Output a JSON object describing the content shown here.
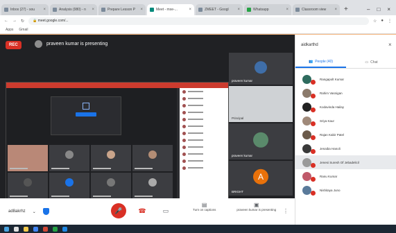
{
  "browser": {
    "tabs": [
      {
        "label": "Inbox (27) - sou"
      },
      {
        "label": "Analysis (980) - n"
      },
      {
        "label": "Prepare Lesson P"
      },
      {
        "label": "Meet - mxe-..."
      },
      {
        "label": "ZMEET - Googl"
      },
      {
        "label": "Whatsapp"
      },
      {
        "label": "Classroom view"
      }
    ],
    "url": "meet.google.com/...",
    "bookmarks": [
      "Apps",
      "Gmail"
    ]
  },
  "meet": {
    "rec_label": "REC",
    "presenter_text": "praveen kumar is presenting",
    "side_tile_names": [
      "praveen kumar",
      "Principal",
      "praveen kumar",
      "BRIGHT"
    ],
    "avatar_letter": "A"
  },
  "controls": {
    "meeting_code": "ad8akrhz",
    "turn_on_captions": "Turn on captions",
    "present_now": "praveen kumar is presenting"
  },
  "panel": {
    "title": "aidkarthd",
    "tab_people": "People (40)",
    "tab_chat": "Chat",
    "participants": [
      "Rangapolt Kumar",
      "Rahim Vasnigan",
      "Kodavinda Hailay",
      "Sriya Kaur",
      "Rajan Kabir Patel",
      "Jenaiba Hanoli",
      "Jenesi Suresh Of Jebadelicil",
      "Ranu Kumar",
      "Nishitaya Juno"
    ]
  }
}
